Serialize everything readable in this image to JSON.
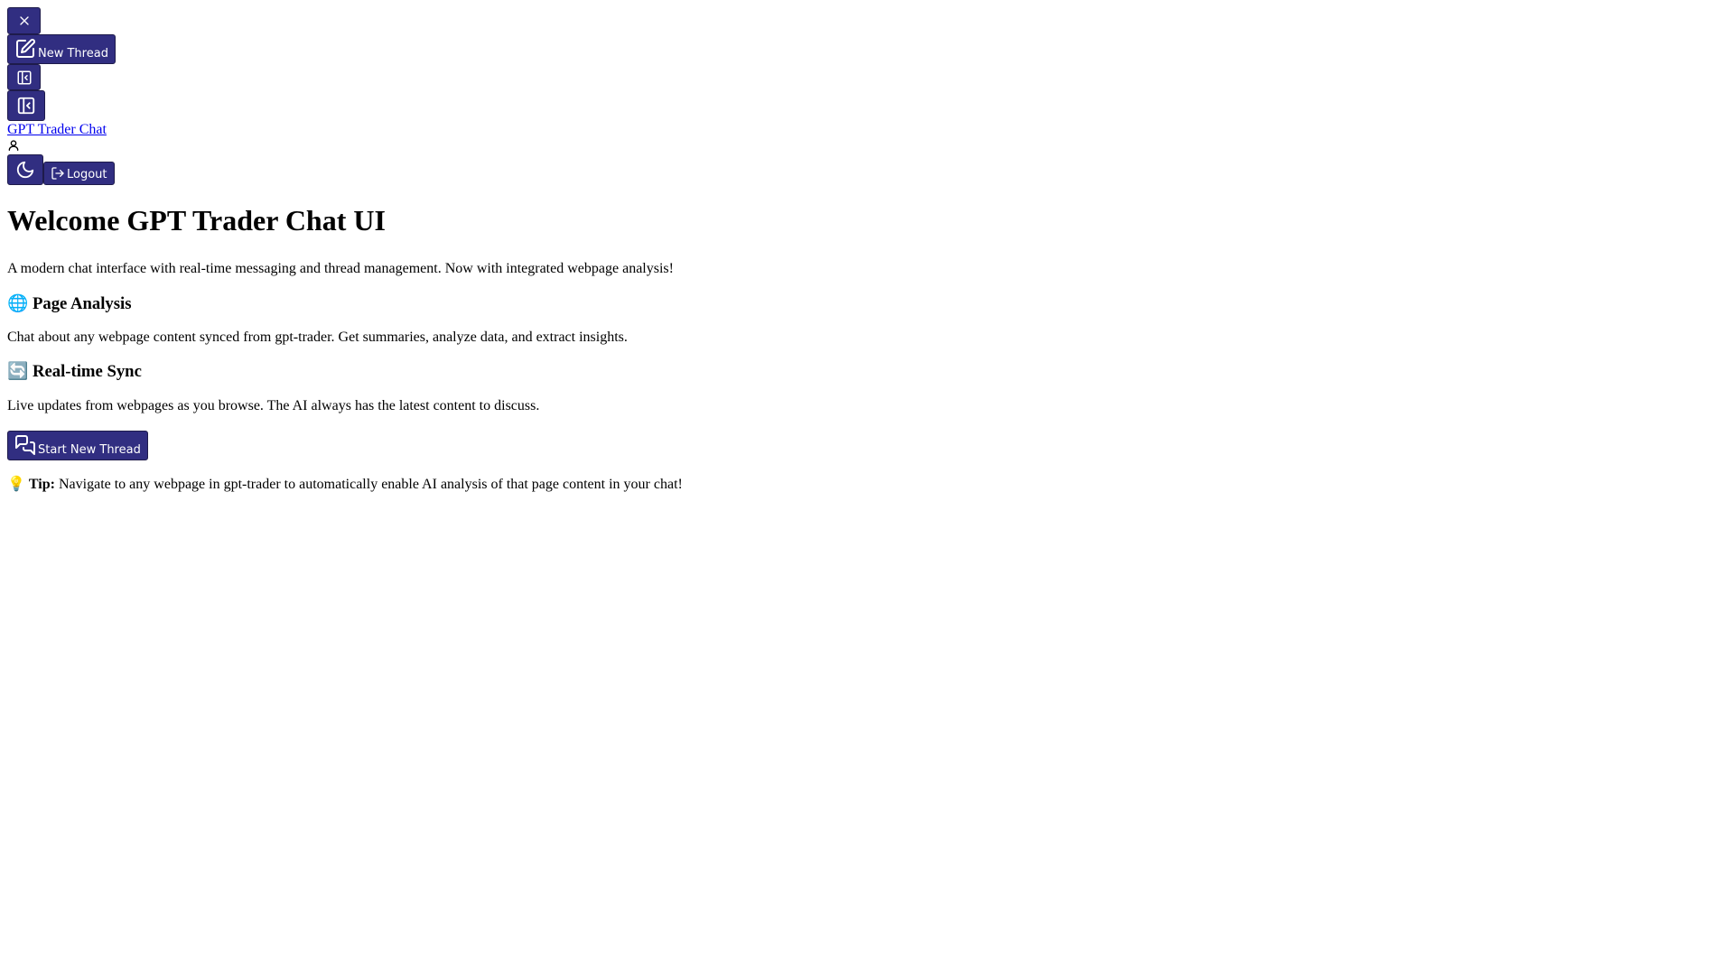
{
  "sidebar": {
    "close_icon": "close-icon",
    "new_thread_label": "New Thread",
    "new_thread_icon": "pencil-square-icon",
    "collapse_icon": "panel-left-close-icon"
  },
  "header": {
    "brand": "GPT Trader Chat",
    "user_icon": "user-icon",
    "theme_icon": "moon-icon",
    "logout_label": "Logout",
    "logout_icon": "logout-icon"
  },
  "welcome": {
    "title": "Welcome GPT Trader Chat UI",
    "subtitle": "A modern chat interface with real-time messaging and thread management. Now with integrated webpage analysis!",
    "features": [
      {
        "emoji": "🌐",
        "heading": "Page Analysis",
        "description": "Chat about any webpage content synced from gpt-trader. Get summaries, analyze data, and extract insights."
      },
      {
        "emoji": "🔄",
        "heading": "Real-time Sync",
        "description": "Live updates from webpages as you browse. The AI always has the latest content to discuss."
      }
    ],
    "start_label": "Start New Thread",
    "start_icon": "chat-bubbles-icon",
    "tip_emoji": "💡",
    "tip_label": "Tip:",
    "tip_text": "Navigate to any webpage in gpt-trader to automatically enable AI analysis of that page content in your chat!"
  },
  "colors": {
    "button_bg": "#312e81",
    "button_text": "#ffffff",
    "link": "#0000ee"
  }
}
